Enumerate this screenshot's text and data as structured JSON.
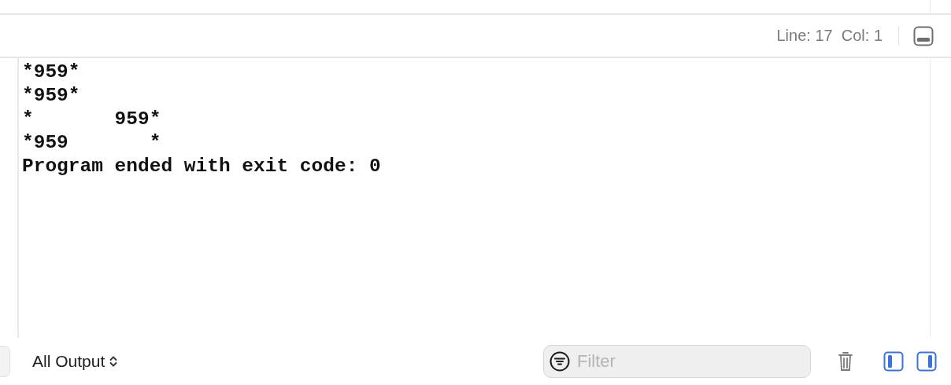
{
  "status_bar": {
    "position": "Line: 17  Col: 1"
  },
  "console": {
    "lines": [
      "*959*",
      "*959*",
      "*       959*",
      "*959       *",
      "Program ended with exit code: 0"
    ]
  },
  "bottom_bar": {
    "output_menu": "All Output",
    "filter": {
      "placeholder": "Filter"
    },
    "panes": [
      {
        "selected": true
      },
      {
        "selected": true
      }
    ]
  }
}
